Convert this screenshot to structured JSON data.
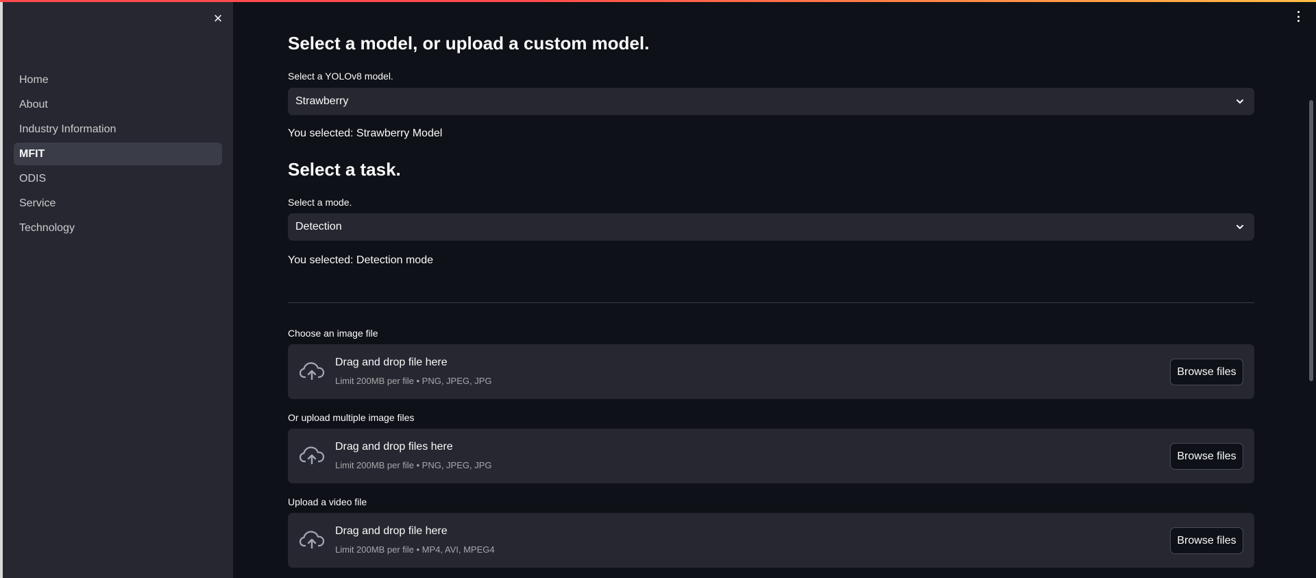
{
  "sidebar": {
    "close_icon": "×",
    "items": [
      {
        "label": "Home",
        "active": false
      },
      {
        "label": "About",
        "active": false
      },
      {
        "label": "Industry Information",
        "active": false
      },
      {
        "label": "MFIT",
        "active": true
      },
      {
        "label": "ODIS",
        "active": false
      },
      {
        "label": "Service",
        "active": false
      },
      {
        "label": "Technology",
        "active": false
      }
    ]
  },
  "main": {
    "model_heading": "Select a model, or upload a custom model.",
    "model_select": {
      "label": "Select a YOLOv8 model.",
      "value": "Strawberry"
    },
    "model_selected_text": "You selected: Strawberry Model",
    "task_heading": "Select a task.",
    "mode_select": {
      "label": "Select a mode.",
      "value": "Detection"
    },
    "mode_selected_text": "You selected: Detection mode",
    "uploaders": [
      {
        "label": "Choose an image file",
        "primary": "Drag and drop file here",
        "secondary": "Limit 200MB per file • PNG, JPEG, JPG",
        "button": "Browse files"
      },
      {
        "label": "Or upload multiple image files",
        "primary": "Drag and drop files here",
        "secondary": "Limit 200MB per file • PNG, JPEG, JPG",
        "button": "Browse files"
      },
      {
        "label": "Upload a video file",
        "primary": "Drag and drop file here",
        "secondary": "Limit 200MB per file • MP4, AVI, MPEG4",
        "button": "Browse files"
      }
    ]
  },
  "colors": {
    "background": "#0e1117",
    "sidebar": "#262730",
    "accent_gradient_start": "#ff4b4b",
    "accent_gradient_end": "#ffbd45"
  },
  "icons": {
    "close": "close-icon",
    "chevron": "chevron-down-icon",
    "upload": "cloud-upload-icon",
    "menu": "more-vertical-icon"
  }
}
